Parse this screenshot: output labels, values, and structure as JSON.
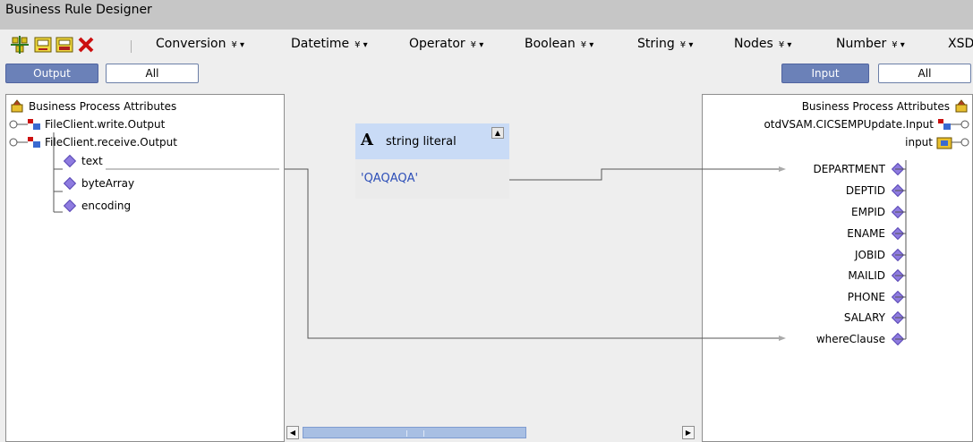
{
  "window": {
    "title": "Business Rule Designer"
  },
  "toolbar": {
    "icons": [
      "add-rule-icon",
      "edit-rule-icon",
      "save-rule-icon",
      "delete-icon"
    ],
    "menus": [
      {
        "label": "Conversion"
      },
      {
        "label": "Datetime"
      },
      {
        "label": "Operator"
      },
      {
        "label": "Boolean"
      },
      {
        "label": "String"
      },
      {
        "label": "Nodes"
      },
      {
        "label": "Number"
      },
      {
        "label": "XSD"
      }
    ]
  },
  "left": {
    "view_output": "Output",
    "view_all": "All",
    "tree": {
      "root": "Business Process Attributes",
      "items": [
        "FileClient.write.Output",
        "FileClient.receive.Output"
      ],
      "children": [
        "text",
        "byteArray",
        "encoding"
      ]
    }
  },
  "right": {
    "view_input": "Input",
    "view_all": "All",
    "tree": {
      "root": "Business Process Attributes",
      "item": "otdVSAM.CICSEMPUpdate.Input",
      "input": "input",
      "fields": [
        "DEPARTMENT",
        "DEPTID",
        "EMPID",
        "ENAME",
        "JOBID",
        "MAILID",
        "PHONE",
        "SALARY",
        "whereClause"
      ]
    }
  },
  "canvas": {
    "node": {
      "icon": "A",
      "title": "string literal",
      "value": "'QAQAQA'"
    }
  },
  "colors": {
    "selected_tab": "#6b81b8",
    "node_header": "#c9dbf6",
    "field_diamond": "#8e7be0"
  }
}
